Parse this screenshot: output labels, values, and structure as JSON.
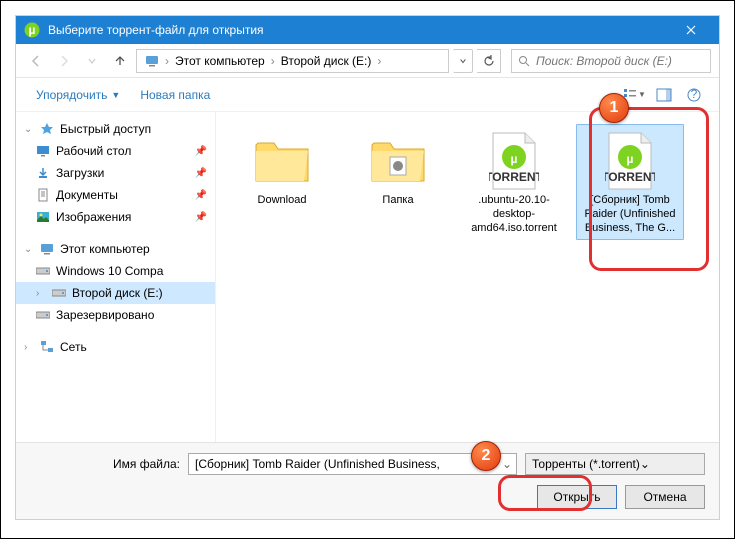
{
  "title": "Выберите торрент-файл для открытия",
  "breadcrumb": {
    "seg1": "Этот компьютер",
    "seg2": "Второй диск (E:)"
  },
  "search_placeholder": "Поиск: Второй диск (E:)",
  "toolbar": {
    "organize": "Упорядочить",
    "newfolder": "Новая папка"
  },
  "sidebar": {
    "quick": "Быстрый доступ",
    "desktop": "Рабочий стол",
    "downloads": "Загрузки",
    "documents": "Документы",
    "pictures": "Изображения",
    "thispc": "Этот компьютер",
    "win10": "Windows 10 Compa",
    "disk2": "Второй диск (E:)",
    "reserved": "Зарезервировано",
    "network": "Сеть"
  },
  "files": {
    "f1": "Download",
    "f2": "Папка",
    "f3_up": "TORRENT",
    "f3": ".ubuntu-20.10-desktop-amd64.iso.torrent",
    "f4_up": "TORRENT",
    "f4": "[Сборник] Tomb Raider (Unfinished Business, The G..."
  },
  "footer": {
    "fname_label": "Имя файла:",
    "fname_value": "[Сборник] Tomb Raider (Unfinished Business,",
    "ftype": "Торренты (*.torrent)",
    "open": "Открыть",
    "cancel": "Отмена"
  },
  "anno": {
    "n1": "1",
    "n2": "2"
  }
}
